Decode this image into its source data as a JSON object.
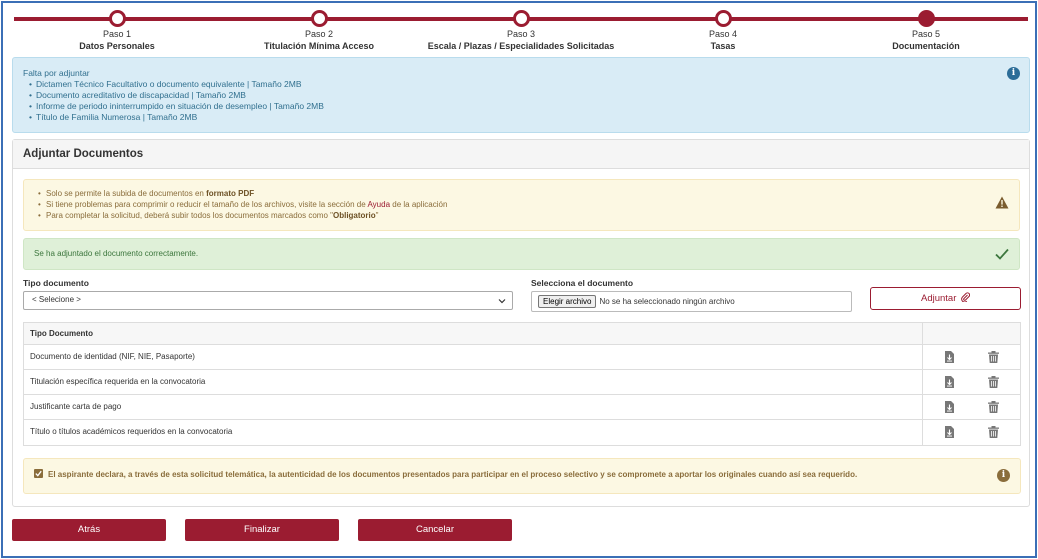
{
  "steps": [
    {
      "num": "Paso 1",
      "name": "Datos Personales",
      "state": "done"
    },
    {
      "num": "Paso 2",
      "name": "Titulación Mínima Acceso",
      "state": "done"
    },
    {
      "num": "Paso 3",
      "name": "Escala / Plazas / Especialidades Solicitadas",
      "state": "done"
    },
    {
      "num": "Paso 4",
      "name": "Tasas",
      "state": "done"
    },
    {
      "num": "Paso 5",
      "name": "Documentación",
      "state": "active"
    }
  ],
  "pending": {
    "title": "Falta por adjuntar",
    "items": [
      "Dictamen Técnico Facultativo o documento equivalente  |  Tamaño 2MB",
      "Documento acreditativo de discapacidad  |  Tamaño 2MB",
      "Informe de periodo ininterrumpido en situación de desempleo  |  Tamaño 2MB",
      "Título de Familia Numerosa  |  Tamaño 2MB"
    ]
  },
  "panel": {
    "title": "Adjuntar Documentos",
    "warnings": {
      "line1_pre": "Solo se permite la subida de documentos en ",
      "line1_bold": "formato PDF",
      "line2_pre": "Si tiene problemas para comprimir o reducir el tamaño de los archivos, visite la sección de ",
      "line2_link": "Ayuda",
      "line2_post": " de la aplicación",
      "line3_pre": "Para completar la solicitud, deberá subir todos los documentos marcados como \"",
      "line3_bold": "Obligatorio",
      "line3_post": "\""
    },
    "success": "Se ha adjuntado el documento correctamente.",
    "tipo_label": "Tipo documento",
    "tipo_value": "< Selecione >",
    "file_label": "Selecciona el documento",
    "file_button": "Elegir archivo",
    "file_status": "No se ha seleccionado ningún archivo",
    "adjuntar_label": "Adjuntar",
    "table_header": "Tipo Documento",
    "rows": [
      "Documento de identidad (NIF, NIE, Pasaporte)",
      "Titulación específica requerida en la convocatoria",
      "Justificante carta de pago",
      "Título o títulos académicos requeridos en la convocatoria"
    ],
    "declaration": "El aspirante declara, a través de esta solicitud telemática, la autenticidad de los documentos presentados para participar en el proceso selectivo y se compromete a aportar los originales cuando así sea requerido."
  },
  "buttons": {
    "back": "Atrás",
    "finish": "Finalizar",
    "cancel": "Cancelar"
  },
  "colors": {
    "accent": "#9b1c31",
    "info_bg": "#d9ecf6",
    "warning_bg": "#fcf8e3",
    "success_bg": "#dff0d8"
  }
}
